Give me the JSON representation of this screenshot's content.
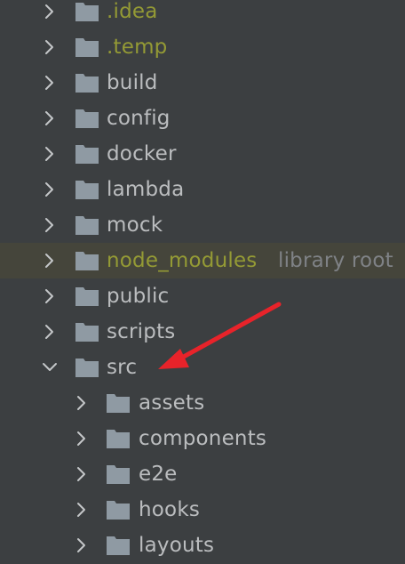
{
  "colors": {
    "background": "#3c3f41",
    "highlight_row": "#45453b",
    "text": "#bbbdbf",
    "ignored_text": "#949a35",
    "hint_text": "#7f8286",
    "folder": "#8f9aa3",
    "annotation_arrow": "#e8232a"
  },
  "tree": {
    "items": [
      {
        "label": ".idea",
        "level": 0,
        "expanded": false,
        "style": "ignored"
      },
      {
        "label": ".temp",
        "level": 0,
        "expanded": false,
        "style": "ignored"
      },
      {
        "label": "build",
        "level": 0,
        "expanded": false,
        "style": "normal"
      },
      {
        "label": "config",
        "level": 0,
        "expanded": false,
        "style": "normal"
      },
      {
        "label": "docker",
        "level": 0,
        "expanded": false,
        "style": "normal"
      },
      {
        "label": "lambda",
        "level": 0,
        "expanded": false,
        "style": "normal"
      },
      {
        "label": "mock",
        "level": 0,
        "expanded": false,
        "style": "normal"
      },
      {
        "label": "node_modules",
        "level": 0,
        "expanded": false,
        "style": "ignored",
        "hint": "library root",
        "highlighted": true
      },
      {
        "label": "public",
        "level": 0,
        "expanded": false,
        "style": "normal"
      },
      {
        "label": "scripts",
        "level": 0,
        "expanded": false,
        "style": "normal"
      },
      {
        "label": "src",
        "level": 0,
        "expanded": true,
        "style": "normal"
      },
      {
        "label": "assets",
        "level": 1,
        "expanded": false,
        "style": "normal"
      },
      {
        "label": "components",
        "level": 1,
        "expanded": false,
        "style": "normal"
      },
      {
        "label": "e2e",
        "level": 1,
        "expanded": false,
        "style": "normal"
      },
      {
        "label": "hooks",
        "level": 1,
        "expanded": false,
        "style": "normal"
      },
      {
        "label": "layouts",
        "level": 1,
        "expanded": false,
        "style": "normal"
      }
    ]
  },
  "icons": {
    "toggle_collapsed": "chevron-right-icon",
    "toggle_expanded": "chevron-down-icon",
    "folder": "folder-icon",
    "annotation": "red-arrow-annotation"
  }
}
